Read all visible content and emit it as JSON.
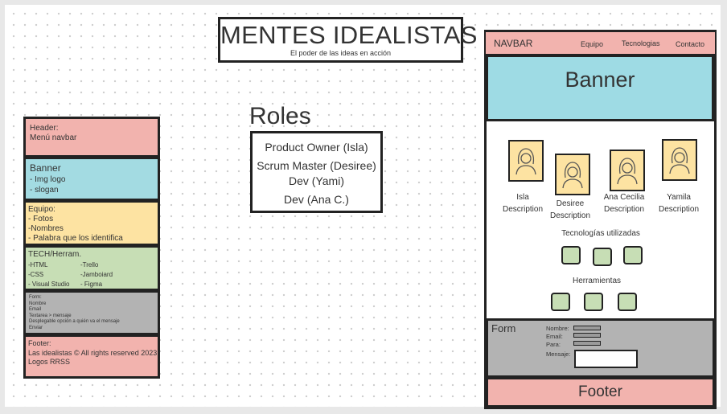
{
  "title": {
    "heading": "MENTES IDEALISTAS",
    "tagline": "El poder de las ideas en acción"
  },
  "roles": {
    "heading": "Roles",
    "items": [
      "Product Owner (Isla)",
      "Scrum Master (Desiree)",
      "Dev (Yami)",
      "Dev (Ana C.)"
    ]
  },
  "sidebar": {
    "header": [
      "Header:",
      "Menú navbar"
    ],
    "banner": [
      "Banner",
      " - Img logo",
      " - slogan"
    ],
    "team": [
      "Equipo:",
      "- Fotos",
      "-Nombres",
      "- Palabra que los identifica"
    ],
    "tech": {
      "title": "TECH/Herram.",
      "col1": [
        "-HTML",
        "-CSS",
        "- Visual Studio"
      ],
      "col2": [
        "-Trello",
        "-Jamboiard",
        "- Figma"
      ]
    },
    "form": [
      "Form:",
      "Nombre",
      "Email",
      "Textarea > mensaje",
      "Desplegable opción a quién va el mensaje",
      "Enviar"
    ],
    "footer": [
      "Footer:",
      "Las idealistas © All rights reserved 2023",
      "Logos RRSS"
    ]
  },
  "wireframe": {
    "navbar": {
      "brand": "NAVBAR",
      "links": [
        "Equipo",
        "Tecnologias",
        "Contacto"
      ]
    },
    "banner": "Banner",
    "members": [
      {
        "name": "Isla",
        "desc": "Description"
      },
      {
        "name": "Desiree",
        "desc": "Description"
      },
      {
        "name": "Ana Cecilia",
        "desc": "Description"
      },
      {
        "name": "Yamila",
        "desc": "Description"
      }
    ],
    "tech_title": "Tecnologías utilizadas",
    "tools_title": "Herramientas",
    "form": {
      "title": "Form",
      "labels": [
        "Nombre:",
        "Email:",
        "Para:",
        "Mensaje:"
      ]
    },
    "footer": "Footer"
  },
  "colors": {
    "header_pink": "#f2b3ae",
    "banner_blue": "#9edbe4",
    "team_yellow": "#fde3a2",
    "tech_green": "#c7deb5",
    "form_gray": "#b3b3b3"
  }
}
